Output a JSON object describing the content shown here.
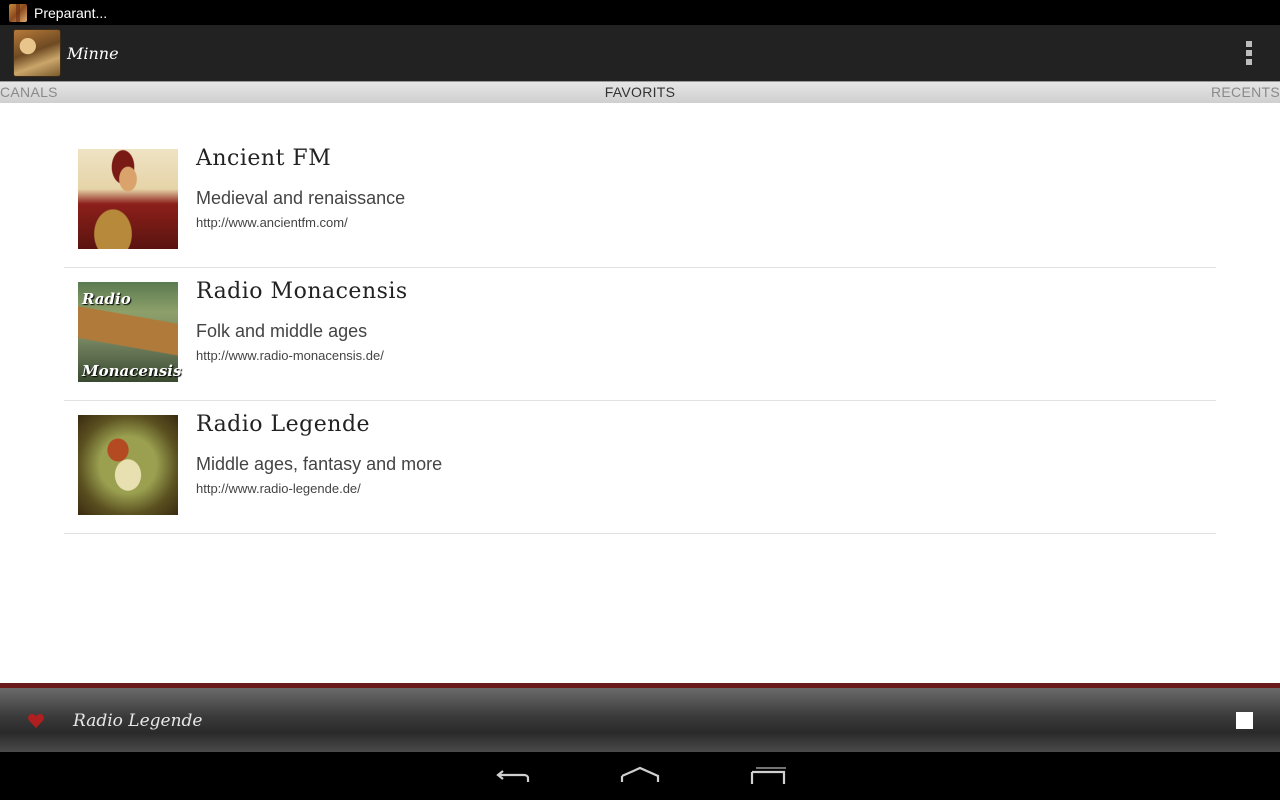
{
  "status_bar": {
    "notification_text": "Preparant..."
  },
  "action_bar": {
    "title": "Minne",
    "overflow_icon": "overflow-menu-icon"
  },
  "tabs": [
    {
      "label": "CANALS",
      "selected": false
    },
    {
      "label": "FAVORITS",
      "selected": true
    },
    {
      "label": "RECENTS",
      "selected": false
    }
  ],
  "stations": [
    {
      "name": "Ancient FM",
      "description": "Medieval and renaissance",
      "url": "http://www.ancientfm.com/"
    },
    {
      "name": "Radio Monacensis",
      "description": "Folk and middle ages",
      "url": "http://www.radio-monacensis.de/",
      "thumb_text_top": "Radio",
      "thumb_text_bottom": "Monacensis"
    },
    {
      "name": "Radio Legende",
      "description": "Middle ages, fantasy and more",
      "url": "http://www.radio-legende.de/"
    }
  ],
  "player": {
    "now_playing": "Radio Legende",
    "favorite_icon": "heart-icon",
    "stop_icon": "stop-icon",
    "accent_color": "#b01f1f"
  },
  "nav_bar": {
    "back_icon": "back-icon",
    "home_icon": "home-icon",
    "recents_icon": "recent-apps-icon"
  }
}
